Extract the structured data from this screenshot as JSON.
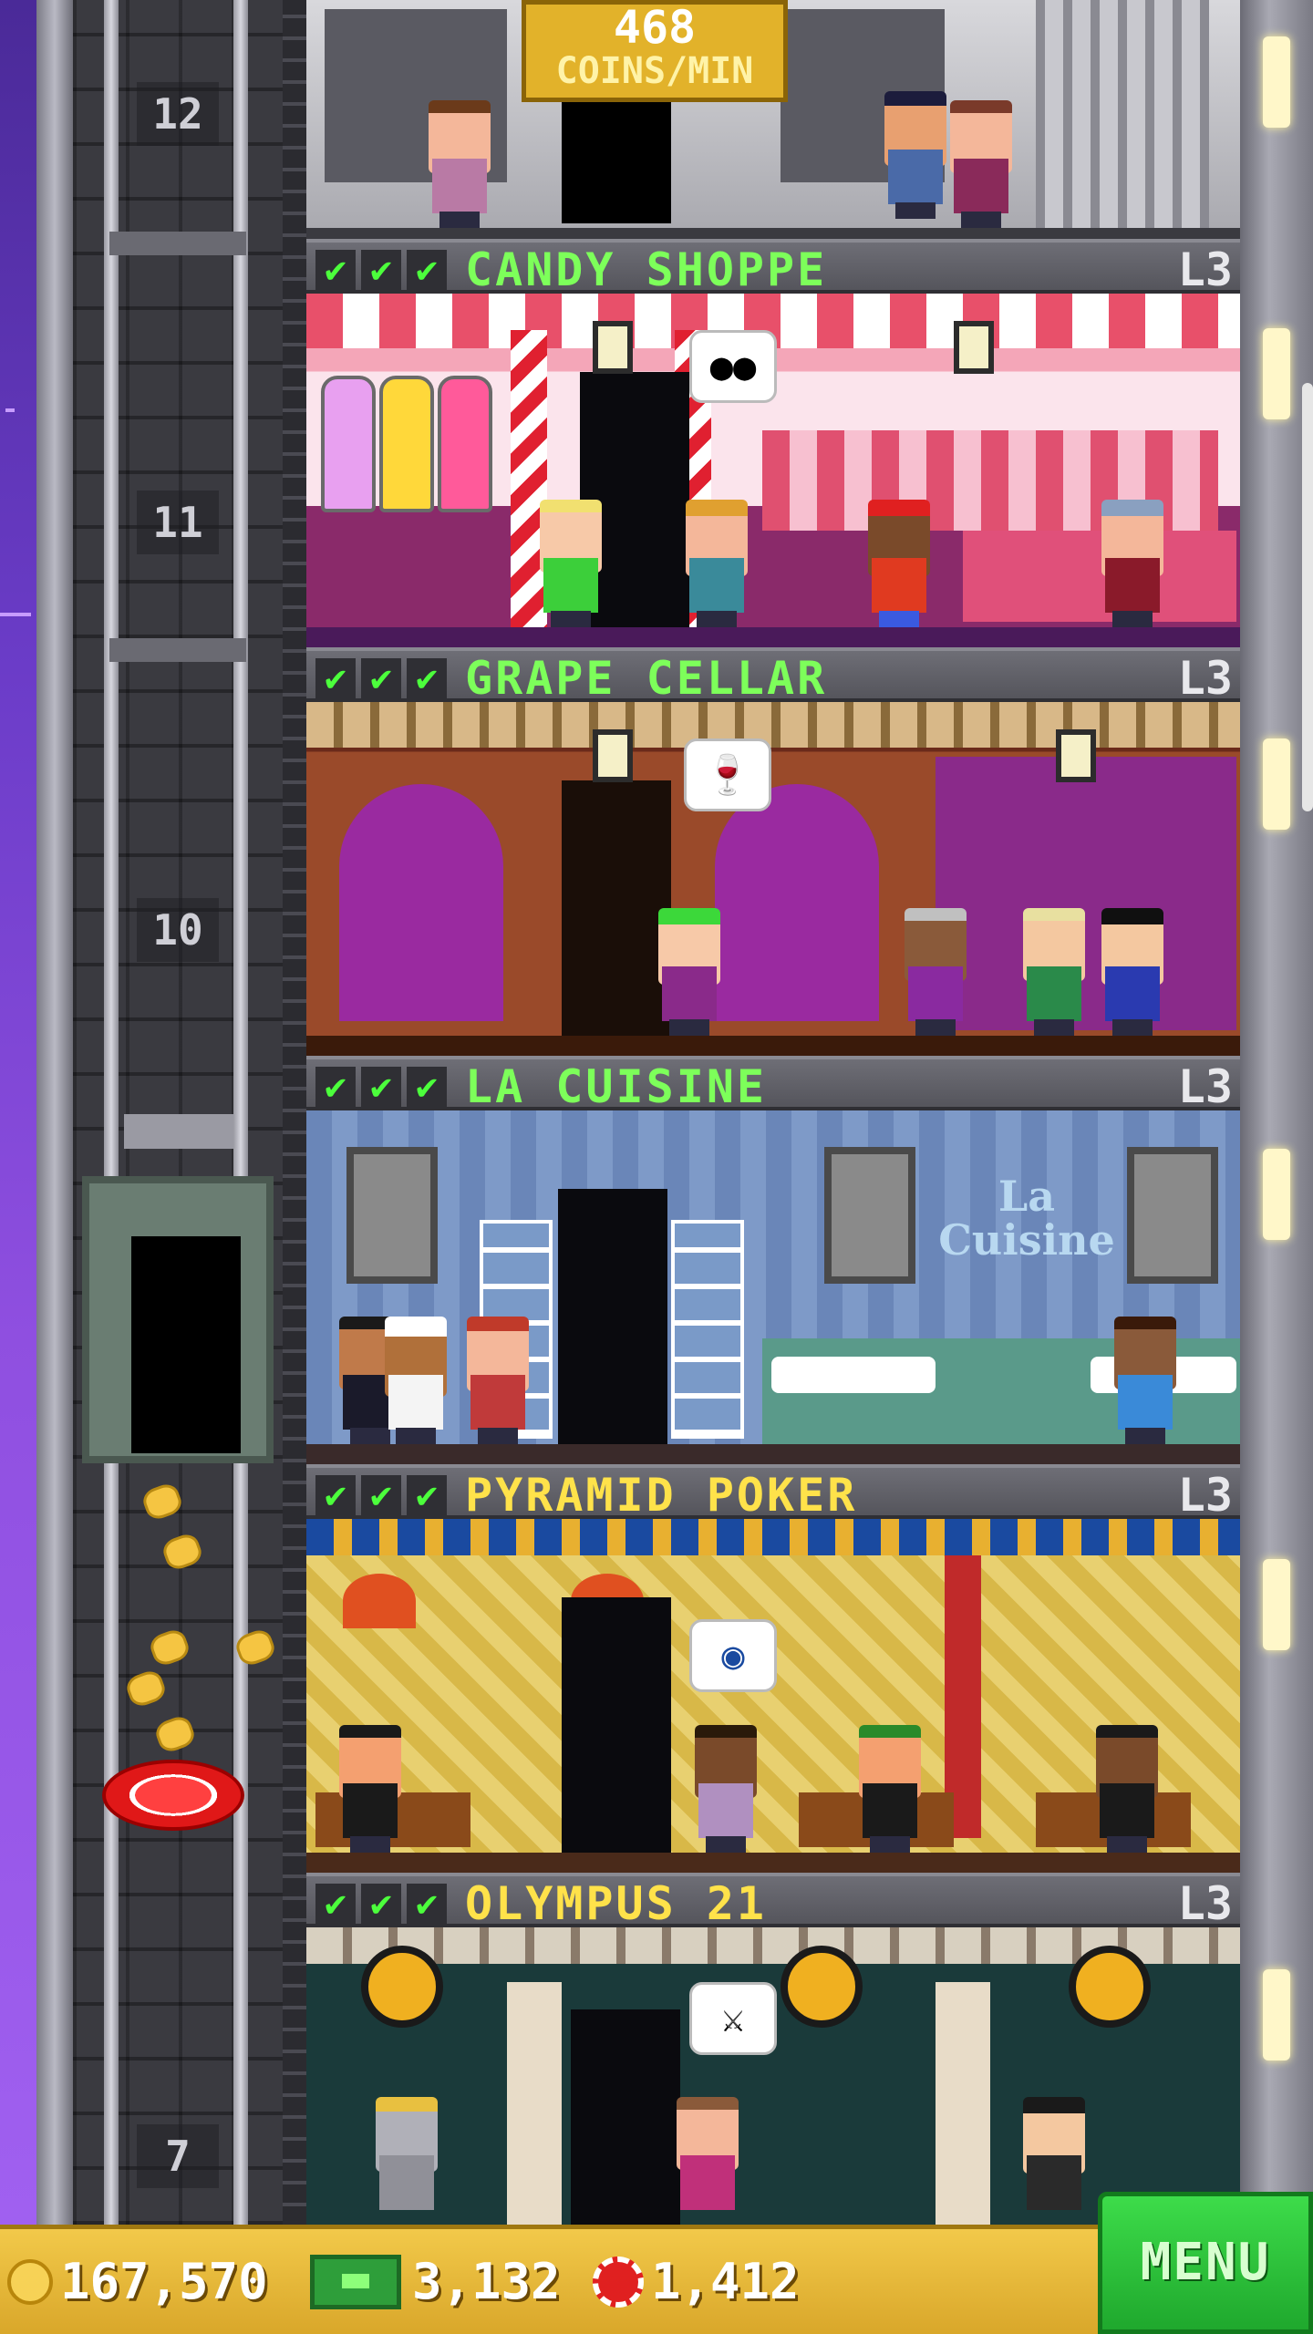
{
  "coins_per_min": {
    "value": "468",
    "label": "COINS/MIN"
  },
  "shaft_floor_numbers": {
    "f12": "12",
    "f11": "11",
    "f10": "10",
    "f7": "7"
  },
  "floors": [
    {
      "name": "CANDY SHOPPE",
      "level": "L3",
      "name_color": "#7dff5a",
      "checks": [
        "✔",
        "✔",
        "✔"
      ],
      "bubble_icon": "candy-icon"
    },
    {
      "name": "GRAPE CELLAR",
      "level": "L3",
      "name_color": "#7dff5a",
      "checks": [
        "✔",
        "✔",
        "✔"
      ],
      "bubble_icon": "wine-glass-icon",
      "bubble_text": "🍷"
    },
    {
      "name": "LA CUISINE",
      "level": "L3",
      "name_color": "#7dff5a",
      "checks": [
        "✔",
        "✔",
        "✔"
      ],
      "sign": "La Cuisine"
    },
    {
      "name": "PYRAMID POKER",
      "level": "L3",
      "name_color": "#ffe24a",
      "checks": [
        "✔",
        "✔",
        "✔"
      ],
      "bubble_icon": "poker-chip-icon"
    },
    {
      "name": "OLYMPUS 21",
      "level": "L3",
      "name_color": "#ffe24a",
      "checks": [
        "✔",
        "✔",
        "✔"
      ],
      "bubble_icon": "viking-helmet-icon"
    }
  ],
  "bottom_bar": {
    "coins": "167,570",
    "bux": "3,132",
    "chips": "1,412",
    "menu_label": "MENU"
  },
  "colors": {
    "accent_green": "#7dff5a",
    "accent_yellow": "#ffe24a",
    "menu_green": "#2ec23c",
    "bar_gold": "#e6b83a"
  }
}
